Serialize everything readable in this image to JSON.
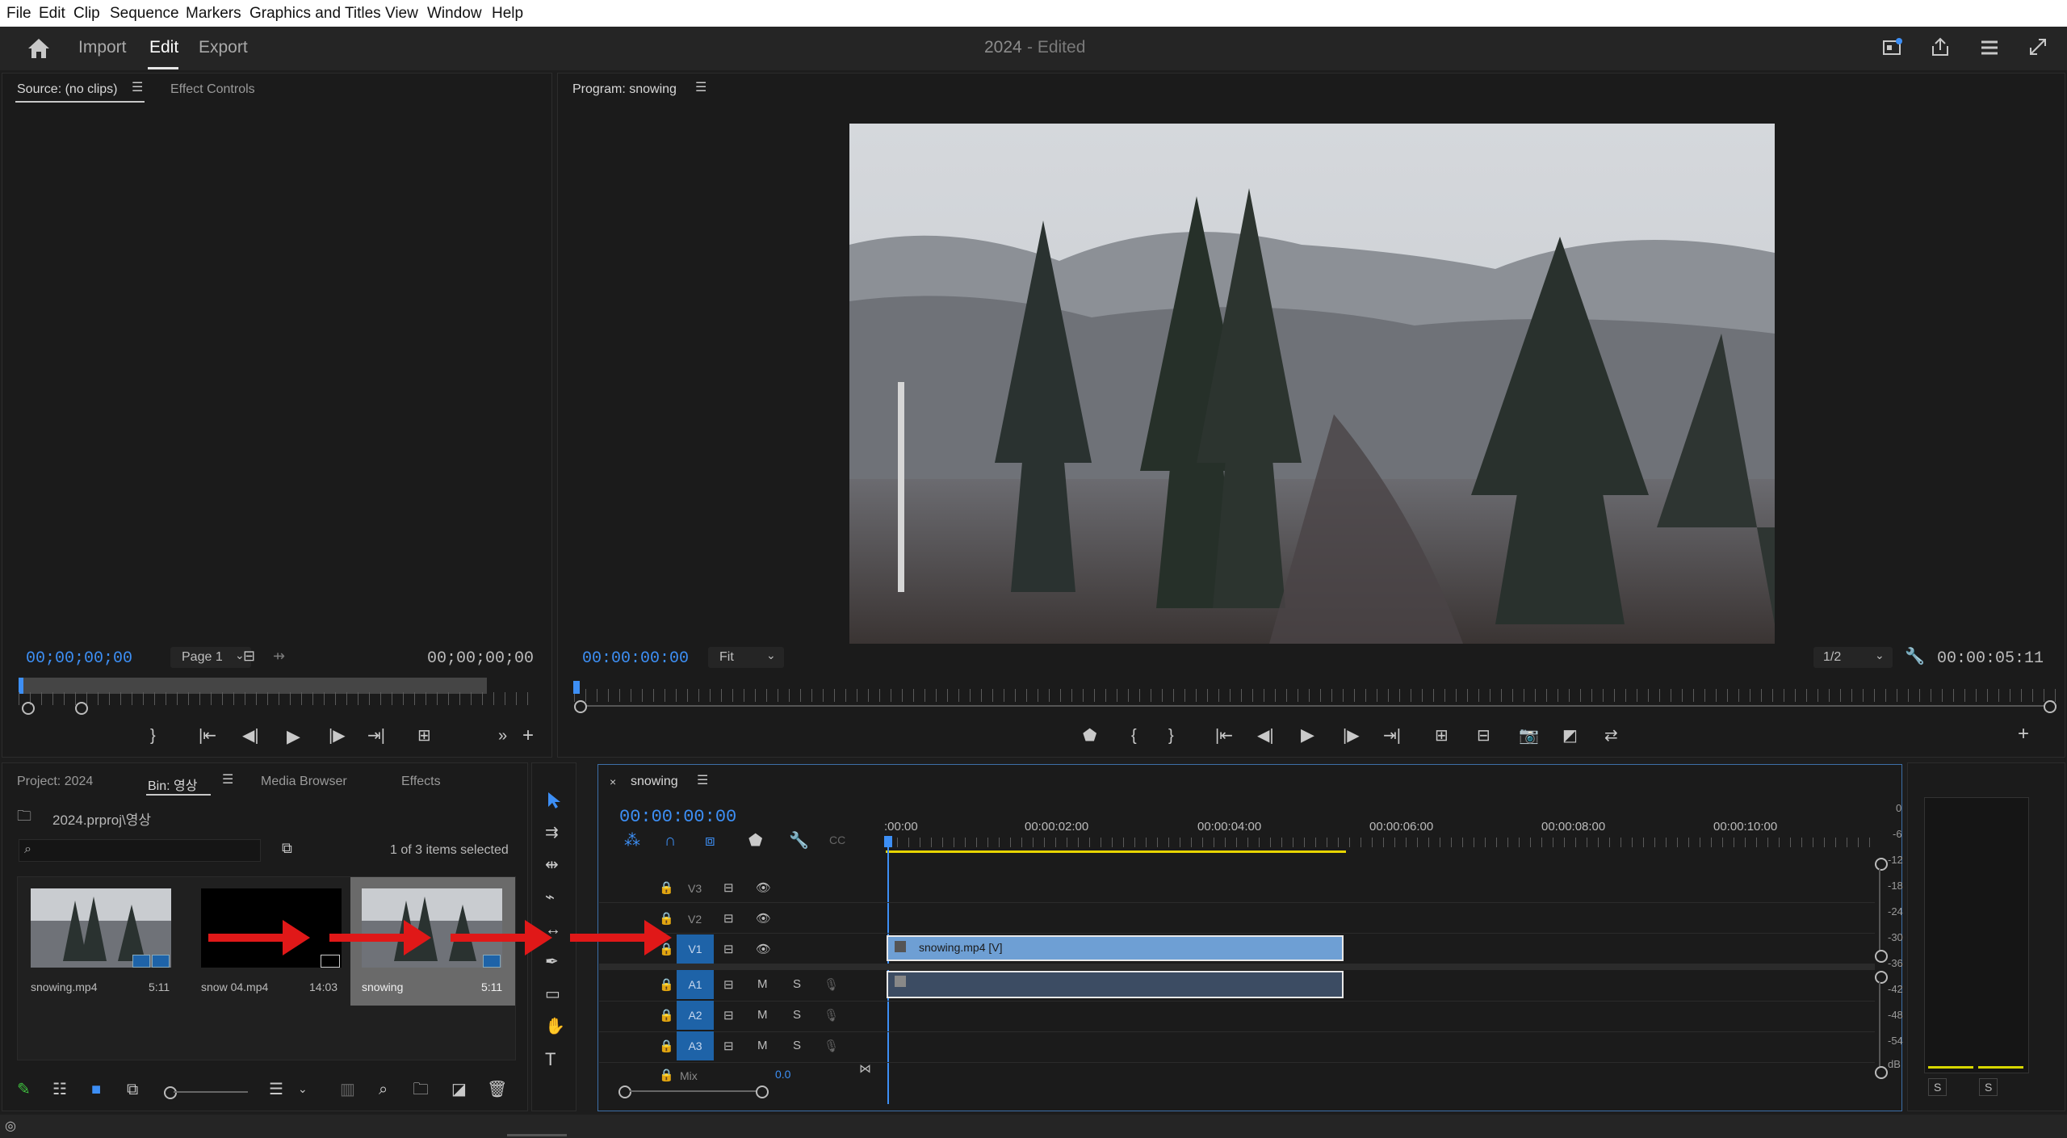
{
  "menu": [
    "File",
    "Edit",
    "Clip",
    "Sequence",
    "Markers",
    "Graphics and Titles",
    "View",
    "Window",
    "Help"
  ],
  "header": {
    "tabs": [
      "Import",
      "Edit",
      "Export"
    ],
    "active_tab": "Edit",
    "project_title": "2024",
    "project_status": "- Edited"
  },
  "source": {
    "tab_label": "Source: (no clips)",
    "effect_controls": "Effect Controls",
    "timecode_left": "00;00;00;00",
    "page_select": "Page 1",
    "timecode_right": "00;00;00;00"
  },
  "program": {
    "tab_label": "Program: snowing",
    "timecode": "00:00:00:00",
    "fit_select": "Fit",
    "resolution_select": "1/2",
    "duration": "00:00:05:11"
  },
  "project": {
    "tab_project": "Project: 2024",
    "tab_bin": "Bin: 영상",
    "tab_media_browser": "Media Browser",
    "tab_effects": "Effects",
    "path": "2024.prproj\\영상",
    "selection_status": "1 of 3 items selected",
    "items": [
      {
        "name": "snowing.mp4",
        "duration": "5:11"
      },
      {
        "name": "snow 04.mp4",
        "duration": "14:03"
      },
      {
        "name": "snowing",
        "duration": "5:11"
      }
    ]
  },
  "timeline": {
    "sequence_name": "snowing",
    "timecode": "00:00:00:00",
    "ruler_labels": [
      ":00:00",
      "00:00:02:00",
      "00:00:04:00",
      "00:00:06:00",
      "00:00:08:00",
      "00:00:10:00"
    ],
    "video_tracks": [
      "V3",
      "V2",
      "V1"
    ],
    "audio_tracks": [
      "A1",
      "A2",
      "A3"
    ],
    "video_clip_label": "snowing.mp4 [V]",
    "mix_label": "Mix",
    "mix_value": "0.0",
    "mute_label": "M",
    "solo_label": "S"
  },
  "audio_meter": {
    "scale": [
      "0",
      "-6",
      "-12",
      "-18",
      "-24",
      "-30",
      "-36",
      "-42",
      "-48",
      "-54",
      "dB"
    ],
    "solo_buttons": [
      "S",
      "S"
    ]
  },
  "colors": {
    "accent_blue": "#3d8ff5",
    "annotation_red": "#e01818",
    "clip_video": "#6e9fd4",
    "clip_audio": "#3c4c63",
    "work_area": "#e8d500"
  }
}
